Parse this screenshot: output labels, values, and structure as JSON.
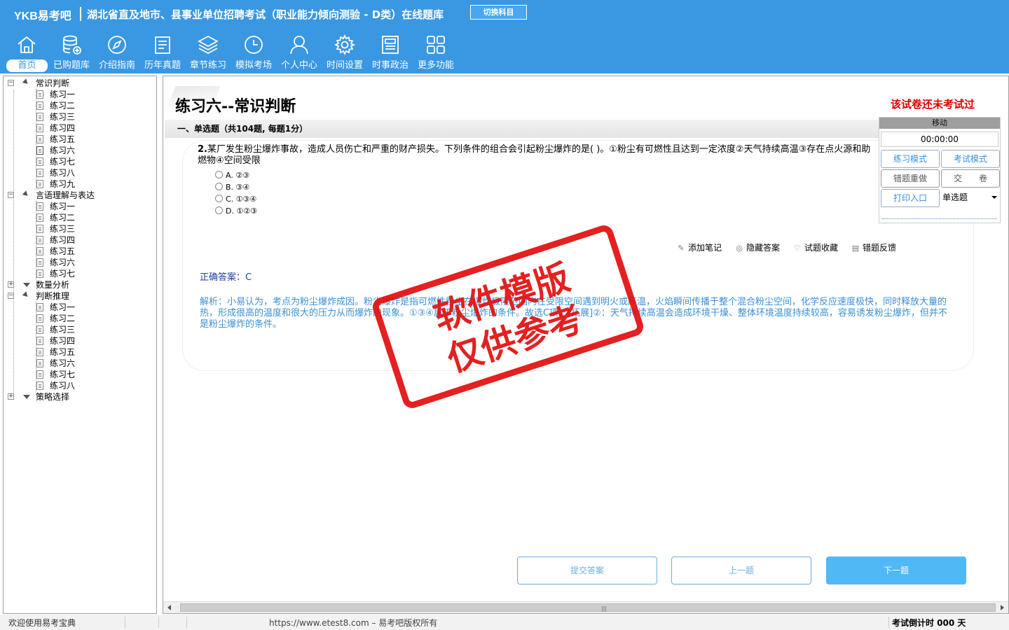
{
  "header": {
    "brand": "YKB易考吧",
    "title": "湖北省直及地市、县事业单位招聘考试（职业能力倾向测验 - D类）在线题库",
    "switch_label": "切换科目",
    "toolbar": [
      {
        "label": "首页",
        "icon": "home-icon",
        "active": true
      },
      {
        "label": "已购题库",
        "icon": "database-icon"
      },
      {
        "label": "介绍指南",
        "icon": "compass-icon"
      },
      {
        "label": "历年真题",
        "icon": "notepad-icon"
      },
      {
        "label": "章节练习",
        "icon": "layers-icon"
      },
      {
        "label": "模拟考场",
        "icon": "clock-icon"
      },
      {
        "label": "个人中心",
        "icon": "user-icon"
      },
      {
        "label": "时间设置",
        "icon": "gear-icon"
      },
      {
        "label": "时事政治",
        "icon": "newspaper-icon"
      },
      {
        "label": "更多功能",
        "icon": "grid-icon"
      }
    ]
  },
  "tree": {
    "groups": [
      {
        "label": "常识判断",
        "expanded": true,
        "items": [
          "练习一",
          "练习二",
          "练习三",
          "练习四",
          "练习五",
          "练习六",
          "练习七",
          "练习八",
          "练习九"
        ],
        "selected": 5
      },
      {
        "label": "言语理解与表达",
        "expanded": true,
        "items": [
          "练习一",
          "练习二",
          "练习三",
          "练习四",
          "练习五",
          "练习六",
          "练习七"
        ]
      },
      {
        "label": "数量分析",
        "expanded": false,
        "items": []
      },
      {
        "label": "判断推理",
        "expanded": true,
        "items": [
          "练习一",
          "练习二",
          "练习三",
          "练习四",
          "练习五",
          "练习六",
          "练习七",
          "练习八"
        ]
      },
      {
        "label": "策略选择",
        "expanded": false,
        "items": []
      }
    ]
  },
  "paper": {
    "title": "练习六--常识判断",
    "status": "该试卷还未考试过",
    "section": "一、单选题（共104题, 每题1分）"
  },
  "question": {
    "number": "2.",
    "text": "某厂发生粉尘爆炸事故，造成人员伤亡和严重的财产损失。下列条件的组合会引起粉尘爆炸的是( )。①粉尘有可燃性且达到一定浓度②天气持续高温③存在点火源和助燃物④空间受限",
    "options": [
      {
        "key": "A.",
        "text": "②③"
      },
      {
        "key": "B.",
        "text": "③④"
      },
      {
        "key": "C.",
        "text": "①③④"
      },
      {
        "key": "D.",
        "text": "①②③"
      }
    ],
    "actions": [
      {
        "label": "添加笔记",
        "icon": "pencil-icon"
      },
      {
        "label": "隐藏答案",
        "icon": "eye-icon"
      },
      {
        "label": "试题收藏",
        "icon": "heart-icon"
      },
      {
        "label": "错题反馈",
        "icon": "feedback-icon"
      }
    ],
    "answer": "正确答案：C",
    "analysis": "解析：小易认为，考点为粉尘爆炸成因。粉尘爆炸是指可燃性粉尘在爆炸极限范围内在受限空间遇到明火或高温，火焰瞬间传播于整个混合粉尘空间，化学反应速度极快，同时释放大量的热，形成很高的温度和很大的压力从而爆炸的现象。①③④属于粉尘爆炸的条件。故选C项。[拓展]②：天气持续高温会造成环境干燥、整体环境温度持续较高，容易诱发粉尘爆炸，但并不是粉尘爆炸的条件。"
  },
  "panel": {
    "header": "移动",
    "timer": "00:00:00",
    "practice_mode": "练习模式",
    "exam_mode": "考试模式",
    "redo_wrong": "错题重做",
    "submit_paper": "交　　卷",
    "print": "打印入口",
    "question_type": "单选题"
  },
  "nav": {
    "submit": "提交答案",
    "prev": "上一题",
    "next": "下一题"
  },
  "stamp": {
    "line1": "软件模版",
    "line2": "仅供参考"
  },
  "status": {
    "welcome": "欢迎使用易考宝典",
    "url": "https://www.etest8.com – 易考吧版权所有",
    "countdown": "考试倒计时 000 天"
  },
  "colors": {
    "header_bg": "#3a97e2",
    "analysis_text": "#3a8fd6",
    "answer_text": "#1f3fa0",
    "status_red": "#dd0000",
    "stamp_red": "#e21010",
    "next_button": "#50b8f5"
  }
}
